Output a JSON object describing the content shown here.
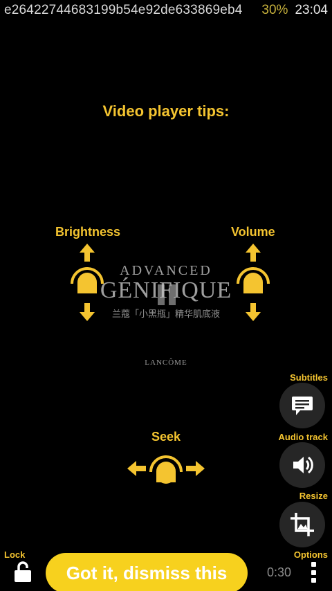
{
  "status_bar": {
    "device_id": "e26422744683199b54e92de633869eb4",
    "battery": "30%",
    "time": "23:04"
  },
  "tips": {
    "title": "Video player tips:",
    "brightness_label": "Brightness",
    "volume_label": "Volume",
    "seek_label": "Seek"
  },
  "ad": {
    "line1": "ADVANCED",
    "line2": "GÉNIFIQUE",
    "line3": "兰蔻「小黑瓶」精华肌底液",
    "brand": "LANCÔME"
  },
  "side_buttons": {
    "subtitles_label": "Subtitles",
    "audio_track_label": "Audio track",
    "resize_label": "Resize"
  },
  "bottom_bar": {
    "lock_label": "Lock",
    "dismiss_label": "Got it, dismiss this",
    "time": "0:30",
    "options_label": "Options"
  },
  "colors": {
    "accent": "#f4c430",
    "button": "#f7d11e",
    "background": "#000000"
  },
  "icons": [
    "lock-icon",
    "subtitles-icon",
    "volume-icon",
    "crop-icon",
    "options-icon",
    "pause-icon",
    "brightness-gesture-icon",
    "volume-gesture-icon",
    "seek-gesture-icon"
  ]
}
